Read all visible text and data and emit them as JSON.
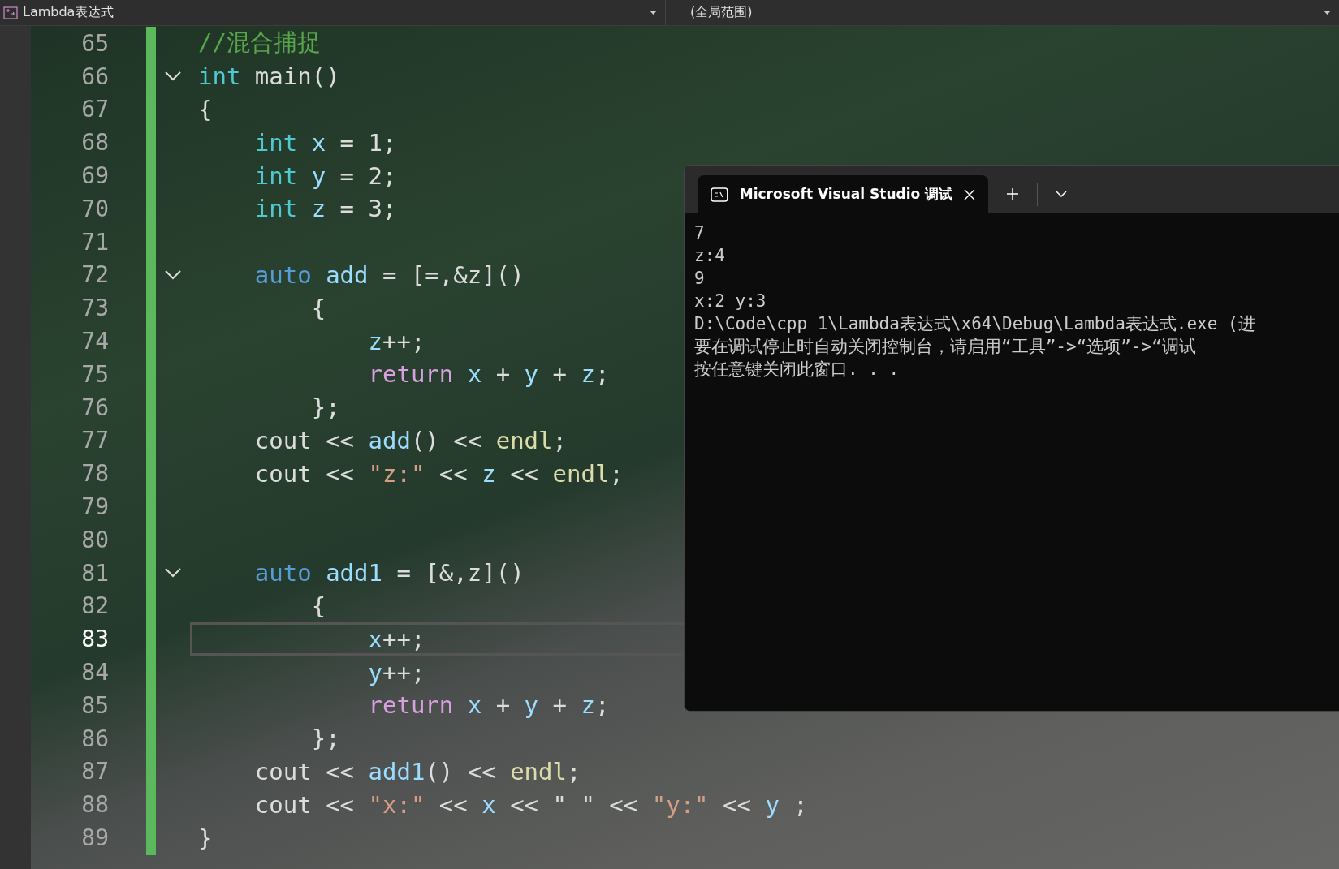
{
  "toolbar": {
    "file_dropdown": "Lambda表达式",
    "scope_dropdown": "(全局范围)"
  },
  "editor": {
    "lines": [
      {
        "num": "65",
        "fold": false,
        "current": false,
        "tokens": [
          {
            "t": "//混合捕捉",
            "kind": "comment"
          }
        ]
      },
      {
        "num": "66",
        "fold": true,
        "current": false,
        "tokens": [
          {
            "t": "int",
            "kind": "type"
          },
          {
            "t": " main()",
            "kind": "plain"
          }
        ]
      },
      {
        "num": "67",
        "fold": false,
        "current": false,
        "tokens": [
          {
            "t": "{",
            "kind": "plain"
          }
        ]
      },
      {
        "num": "68",
        "fold": false,
        "current": false,
        "tokens": [
          {
            "t": "    int",
            "kind": "type"
          },
          {
            "t": " x",
            "kind": "var"
          },
          {
            "t": " = 1;",
            "kind": "plain"
          }
        ]
      },
      {
        "num": "69",
        "fold": false,
        "current": false,
        "tokens": [
          {
            "t": "    int",
            "kind": "type"
          },
          {
            "t": " y",
            "kind": "var"
          },
          {
            "t": " = 2;",
            "kind": "plain"
          }
        ]
      },
      {
        "num": "70",
        "fold": false,
        "current": false,
        "tokens": [
          {
            "t": "    int",
            "kind": "type"
          },
          {
            "t": " z",
            "kind": "var"
          },
          {
            "t": " = 3;",
            "kind": "plain"
          }
        ]
      },
      {
        "num": "71",
        "fold": false,
        "current": false
      },
      {
        "num": "72",
        "fold": true,
        "current": false,
        "tokens": [
          {
            "t": "    auto",
            "kind": "kw"
          },
          {
            "t": " add",
            "kind": "var"
          },
          {
            "t": " = [=,&z]()",
            "kind": "plain"
          }
        ]
      },
      {
        "num": "73",
        "fold": false,
        "current": false,
        "tokens": [
          {
            "t": "        {",
            "kind": "plain"
          }
        ]
      },
      {
        "num": "74",
        "fold": false,
        "current": false,
        "tokens": [
          {
            "t": "            z",
            "kind": "var"
          },
          {
            "t": "++;",
            "kind": "plain"
          }
        ]
      },
      {
        "num": "75",
        "fold": false,
        "current": false,
        "tokens": [
          {
            "t": "            return",
            "kind": "ctrl"
          },
          {
            "t": " x",
            "kind": "var"
          },
          {
            "t": " + ",
            "kind": "plain"
          },
          {
            "t": "y",
            "kind": "var"
          },
          {
            "t": " + ",
            "kind": "plain"
          },
          {
            "t": "z",
            "kind": "var"
          },
          {
            "t": ";",
            "kind": "plain"
          }
        ]
      },
      {
        "num": "76",
        "fold": false,
        "current": false,
        "tokens": [
          {
            "t": "        };",
            "kind": "plain"
          }
        ]
      },
      {
        "num": "77",
        "fold": false,
        "current": false,
        "tokens": [
          {
            "t": "    cout << ",
            "kind": "plain"
          },
          {
            "t": "add",
            "kind": "var"
          },
          {
            "t": "() << ",
            "kind": "plain"
          },
          {
            "t": "endl",
            "kind": "fn"
          },
          {
            "t": ";",
            "kind": "plain"
          }
        ]
      },
      {
        "num": "78",
        "fold": false,
        "current": false,
        "tokens": [
          {
            "t": "    cout << ",
            "kind": "plain"
          },
          {
            "t": "\"z:\"",
            "kind": "str"
          },
          {
            "t": " << ",
            "kind": "plain"
          },
          {
            "t": "z",
            "kind": "var"
          },
          {
            "t": " << ",
            "kind": "plain"
          },
          {
            "t": "endl",
            "kind": "fn"
          },
          {
            "t": ";",
            "kind": "plain"
          }
        ]
      },
      {
        "num": "79",
        "fold": false,
        "current": false
      },
      {
        "num": "80",
        "fold": false,
        "current": false
      },
      {
        "num": "81",
        "fold": true,
        "current": false,
        "tokens": [
          {
            "t": "    auto",
            "kind": "kw"
          },
          {
            "t": " add1",
            "kind": "var"
          },
          {
            "t": " = [&,z]()",
            "kind": "plain"
          }
        ]
      },
      {
        "num": "82",
        "fold": false,
        "current": false,
        "tokens": [
          {
            "t": "        {",
            "kind": "plain"
          }
        ]
      },
      {
        "num": "83",
        "fold": false,
        "current": true,
        "tokens": [
          {
            "t": "            x",
            "kind": "var"
          },
          {
            "t": "++;",
            "kind": "plain"
          }
        ]
      },
      {
        "num": "84",
        "fold": false,
        "current": false,
        "tokens": [
          {
            "t": "            y",
            "kind": "var"
          },
          {
            "t": "++;",
            "kind": "plain"
          }
        ]
      },
      {
        "num": "85",
        "fold": false,
        "current": false,
        "tokens": [
          {
            "t": "            return",
            "kind": "ctrl"
          },
          {
            "t": " x",
            "kind": "var"
          },
          {
            "t": " + ",
            "kind": "plain"
          },
          {
            "t": "y",
            "kind": "var"
          },
          {
            "t": " + ",
            "kind": "plain"
          },
          {
            "t": "z",
            "kind": "var"
          },
          {
            "t": ";",
            "kind": "plain"
          }
        ]
      },
      {
        "num": "86",
        "fold": false,
        "current": false,
        "tokens": [
          {
            "t": "        };",
            "kind": "plain"
          }
        ]
      },
      {
        "num": "87",
        "fold": false,
        "current": false,
        "tokens": [
          {
            "t": "    cout << ",
            "kind": "plain"
          },
          {
            "t": "add1",
            "kind": "var"
          },
          {
            "t": "() << ",
            "kind": "plain"
          },
          {
            "t": "endl",
            "kind": "fn"
          },
          {
            "t": ";",
            "kind": "plain"
          }
        ]
      },
      {
        "num": "88",
        "fold": false,
        "current": false,
        "tokens": [
          {
            "t": "    cout << ",
            "kind": "plain"
          },
          {
            "t": "\"x:\"",
            "kind": "str"
          },
          {
            "t": " << ",
            "kind": "plain"
          },
          {
            "t": "x",
            "kind": "var"
          },
          {
            "t": " << \" \" << ",
            "kind": "plain"
          },
          {
            "t": "\"y:\"",
            "kind": "str"
          },
          {
            "t": " << ",
            "kind": "plain"
          },
          {
            "t": "y",
            "kind": "var"
          },
          {
            "t": " ;",
            "kind": "plain"
          }
        ]
      },
      {
        "num": "89",
        "fold": false,
        "current": false,
        "tokens": [
          {
            "t": "}",
            "kind": "plain"
          }
        ]
      }
    ]
  },
  "console": {
    "tab_title": "Microsoft Visual Studio 调试",
    "output": [
      "7",
      "z:4",
      "9",
      "x:2 y:3",
      "D:\\Code\\cpp_1\\Lambda表达式\\x64\\Debug\\Lambda表达式.exe (进",
      "要在调试停止时自动关闭控制台，请启用“工具”->“选项”->“调试",
      "按任意键关闭此窗口. . ."
    ]
  }
}
